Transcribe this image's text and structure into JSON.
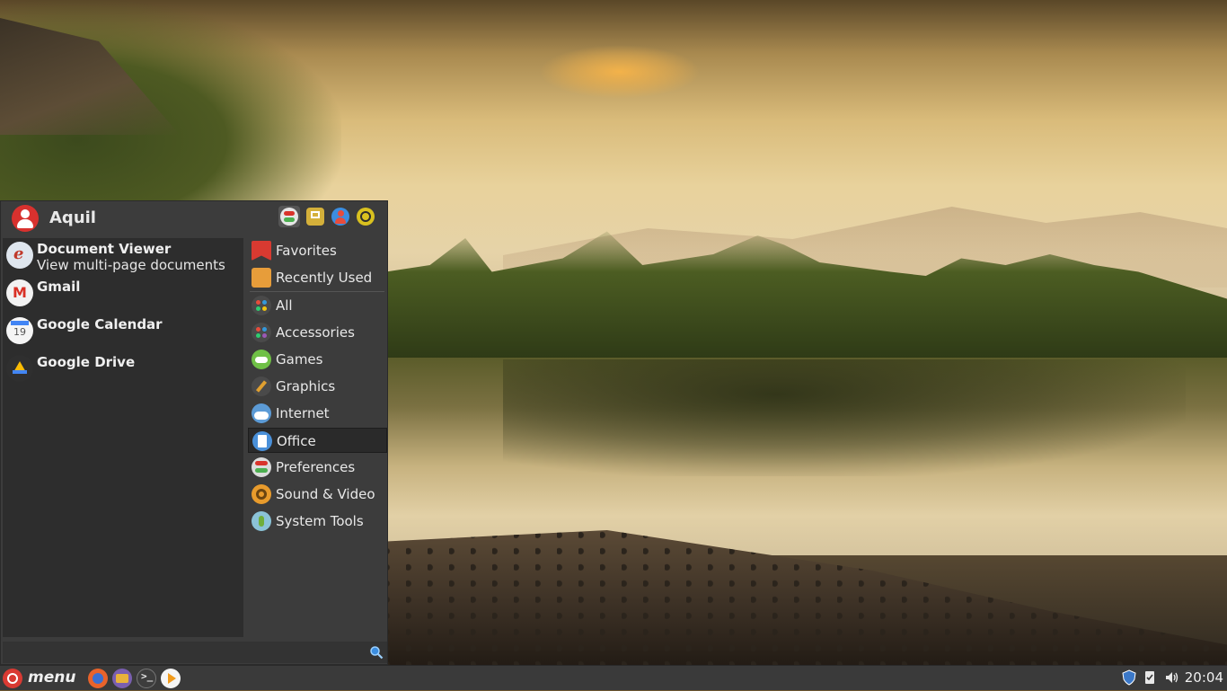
{
  "user": {
    "name": "Aquil"
  },
  "header_buttons": [
    {
      "icon": "preferences-toggle-icon",
      "color": "#d9342b"
    },
    {
      "icon": "software-manager-icon",
      "color": "#d4b03a"
    },
    {
      "icon": "user-account-icon",
      "color": "#3b8de0"
    },
    {
      "icon": "logout-icon",
      "color": "#d9c11f"
    }
  ],
  "favorites": [
    {
      "name": "Document Viewer",
      "desc": "View multi-page documents",
      "icon": "document-viewer-icon",
      "color": "#dfe6ee"
    },
    {
      "name": "Gmail",
      "desc": "",
      "icon": "gmail-icon",
      "color": "#f2f2f2"
    },
    {
      "name": "Google Calendar",
      "desc": "",
      "icon": "google-calendar-icon",
      "color": "#f5f5f5"
    },
    {
      "name": "Google Drive",
      "desc": "",
      "icon": "google-drive-icon",
      "color": "#2f2f2f"
    }
  ],
  "categories": [
    {
      "label": "Favorites",
      "icon": "favorites-bookmark-icon",
      "color": "#d83a31"
    },
    {
      "label": "Recently Used",
      "icon": "recently-used-icon",
      "color": "#e79d3a"
    },
    {
      "label": "All",
      "icon": "all-apps-icon",
      "color": "#4a4a4a"
    },
    {
      "label": "Accessories",
      "icon": "accessories-icon",
      "color": "#4a4a4a"
    },
    {
      "label": "Games",
      "icon": "games-icon",
      "color": "#6fc046"
    },
    {
      "label": "Graphics",
      "icon": "graphics-icon",
      "color": "#4a4a4a"
    },
    {
      "label": "Internet",
      "icon": "internet-icon",
      "color": "#5c9bd6"
    },
    {
      "label": "Office",
      "icon": "office-icon",
      "color": "#4a90d9"
    },
    {
      "label": "Preferences",
      "icon": "preferences-icon",
      "color": "#dcdcdc"
    },
    {
      "label": "Sound & Video",
      "icon": "sound-video-icon",
      "color": "#e89b2c"
    },
    {
      "label": "System Tools",
      "icon": "system-tools-icon",
      "color": "#8bc3d8"
    }
  ],
  "active_category": "Office",
  "search": {
    "placeholder": ""
  },
  "taskbar": {
    "menu_label": "menu",
    "launchers": [
      {
        "icon": "firefox-icon",
        "color": "#e8632b"
      },
      {
        "icon": "files-icon",
        "color": "#e8b23a"
      },
      {
        "icon": "terminal-icon",
        "color": "#3d3d3d"
      },
      {
        "icon": "media-player-icon",
        "color": "#f29b1a"
      }
    ],
    "tray": [
      {
        "icon": "shield-update-icon"
      },
      {
        "icon": "clipboard-icon"
      },
      {
        "icon": "volume-icon"
      }
    ],
    "clock": "20:04"
  }
}
